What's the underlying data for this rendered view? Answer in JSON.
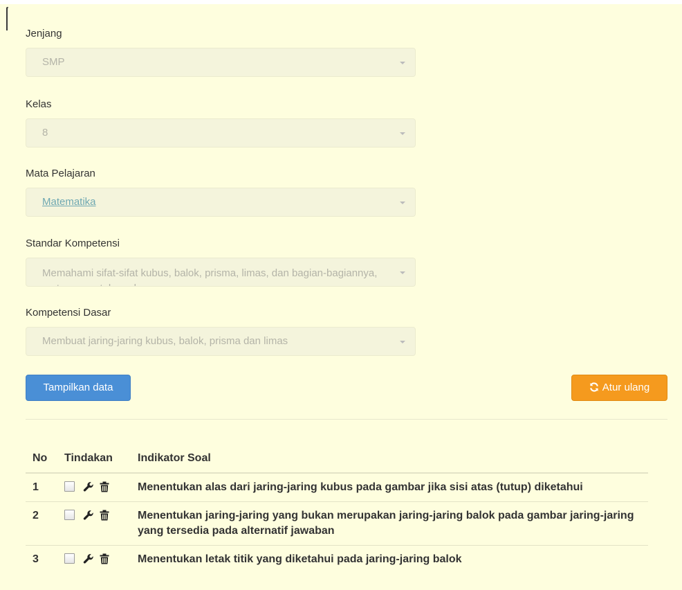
{
  "form": {
    "jenjang": {
      "label": "Jenjang",
      "value": "SMP"
    },
    "kelas": {
      "label": "Kelas",
      "value": "8"
    },
    "mapel": {
      "label": "Mata Pelajaran",
      "value": "Matematika"
    },
    "standar": {
      "label": "Standar Kompetensi",
      "value": "Memahami sifat-sifat kubus, balok, prisma, limas, dan bagian-bagiannya, serta menentukan ukurannya"
    },
    "kompetensi": {
      "label": "Kompetensi Dasar",
      "value": "Membuat jaring-jaring kubus, balok, prisma dan limas"
    }
  },
  "buttons": {
    "tampilkan": "Tampilkan data",
    "atur_ulang": "Atur ulang"
  },
  "table": {
    "headers": {
      "no": "No",
      "tindakan": "Tindakan",
      "indikator": "Indikator Soal"
    },
    "rows": [
      {
        "no": "1",
        "indikator": "Menentukan alas dari jaring-jaring kubus pada gambar jika sisi atas (tutup) diketahui"
      },
      {
        "no": "2",
        "indikator": "Menentukan jaring-jaring yang bukan merupakan jaring-jaring balok pada gambar jaring-jaring yang tersedia pada alternatif jawaban"
      },
      {
        "no": "3",
        "indikator": "Menentukan letak titik yang diketahui pada jaring-jaring balok"
      }
    ]
  },
  "icons": {
    "edit": "wrench-icon",
    "delete": "trash-icon",
    "reset": "refresh-icon"
  },
  "colors": {
    "background": "#fefede",
    "primary": "#4a8fd6",
    "warning": "#f59a1e"
  }
}
